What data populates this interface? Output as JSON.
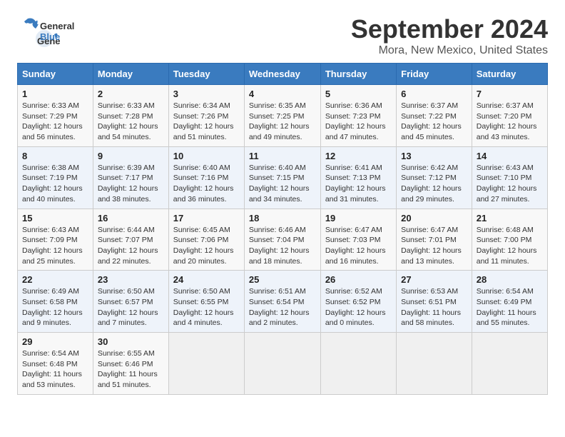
{
  "header": {
    "logo_general": "General",
    "logo_blue": "Blue",
    "month": "September 2024",
    "location": "Mora, New Mexico, United States"
  },
  "calendar": {
    "weekdays": [
      "Sunday",
      "Monday",
      "Tuesday",
      "Wednesday",
      "Thursday",
      "Friday",
      "Saturday"
    ],
    "weeks": [
      [
        {
          "day": "1",
          "info": "Sunrise: 6:33 AM\nSunset: 7:29 PM\nDaylight: 12 hours\nand 56 minutes."
        },
        {
          "day": "2",
          "info": "Sunrise: 6:33 AM\nSunset: 7:28 PM\nDaylight: 12 hours\nand 54 minutes."
        },
        {
          "day": "3",
          "info": "Sunrise: 6:34 AM\nSunset: 7:26 PM\nDaylight: 12 hours\nand 51 minutes."
        },
        {
          "day": "4",
          "info": "Sunrise: 6:35 AM\nSunset: 7:25 PM\nDaylight: 12 hours\nand 49 minutes."
        },
        {
          "day": "5",
          "info": "Sunrise: 6:36 AM\nSunset: 7:23 PM\nDaylight: 12 hours\nand 47 minutes."
        },
        {
          "day": "6",
          "info": "Sunrise: 6:37 AM\nSunset: 7:22 PM\nDaylight: 12 hours\nand 45 minutes."
        },
        {
          "day": "7",
          "info": "Sunrise: 6:37 AM\nSunset: 7:20 PM\nDaylight: 12 hours\nand 43 minutes."
        }
      ],
      [
        {
          "day": "8",
          "info": "Sunrise: 6:38 AM\nSunset: 7:19 PM\nDaylight: 12 hours\nand 40 minutes."
        },
        {
          "day": "9",
          "info": "Sunrise: 6:39 AM\nSunset: 7:17 PM\nDaylight: 12 hours\nand 38 minutes."
        },
        {
          "day": "10",
          "info": "Sunrise: 6:40 AM\nSunset: 7:16 PM\nDaylight: 12 hours\nand 36 minutes."
        },
        {
          "day": "11",
          "info": "Sunrise: 6:40 AM\nSunset: 7:15 PM\nDaylight: 12 hours\nand 34 minutes."
        },
        {
          "day": "12",
          "info": "Sunrise: 6:41 AM\nSunset: 7:13 PM\nDaylight: 12 hours\nand 31 minutes."
        },
        {
          "day": "13",
          "info": "Sunrise: 6:42 AM\nSunset: 7:12 PM\nDaylight: 12 hours\nand 29 minutes."
        },
        {
          "day": "14",
          "info": "Sunrise: 6:43 AM\nSunset: 7:10 PM\nDaylight: 12 hours\nand 27 minutes."
        }
      ],
      [
        {
          "day": "15",
          "info": "Sunrise: 6:43 AM\nSunset: 7:09 PM\nDaylight: 12 hours\nand 25 minutes."
        },
        {
          "day": "16",
          "info": "Sunrise: 6:44 AM\nSunset: 7:07 PM\nDaylight: 12 hours\nand 22 minutes."
        },
        {
          "day": "17",
          "info": "Sunrise: 6:45 AM\nSunset: 7:06 PM\nDaylight: 12 hours\nand 20 minutes."
        },
        {
          "day": "18",
          "info": "Sunrise: 6:46 AM\nSunset: 7:04 PM\nDaylight: 12 hours\nand 18 minutes."
        },
        {
          "day": "19",
          "info": "Sunrise: 6:47 AM\nSunset: 7:03 PM\nDaylight: 12 hours\nand 16 minutes."
        },
        {
          "day": "20",
          "info": "Sunrise: 6:47 AM\nSunset: 7:01 PM\nDaylight: 12 hours\nand 13 minutes."
        },
        {
          "day": "21",
          "info": "Sunrise: 6:48 AM\nSunset: 7:00 PM\nDaylight: 12 hours\nand 11 minutes."
        }
      ],
      [
        {
          "day": "22",
          "info": "Sunrise: 6:49 AM\nSunset: 6:58 PM\nDaylight: 12 hours\nand 9 minutes."
        },
        {
          "day": "23",
          "info": "Sunrise: 6:50 AM\nSunset: 6:57 PM\nDaylight: 12 hours\nand 7 minutes."
        },
        {
          "day": "24",
          "info": "Sunrise: 6:50 AM\nSunset: 6:55 PM\nDaylight: 12 hours\nand 4 minutes."
        },
        {
          "day": "25",
          "info": "Sunrise: 6:51 AM\nSunset: 6:54 PM\nDaylight: 12 hours\nand 2 minutes."
        },
        {
          "day": "26",
          "info": "Sunrise: 6:52 AM\nSunset: 6:52 PM\nDaylight: 12 hours\nand 0 minutes."
        },
        {
          "day": "27",
          "info": "Sunrise: 6:53 AM\nSunset: 6:51 PM\nDaylight: 11 hours\nand 58 minutes."
        },
        {
          "day": "28",
          "info": "Sunrise: 6:54 AM\nSunset: 6:49 PM\nDaylight: 11 hours\nand 55 minutes."
        }
      ],
      [
        {
          "day": "29",
          "info": "Sunrise: 6:54 AM\nSunset: 6:48 PM\nDaylight: 11 hours\nand 53 minutes."
        },
        {
          "day": "30",
          "info": "Sunrise: 6:55 AM\nSunset: 6:46 PM\nDaylight: 11 hours\nand 51 minutes."
        },
        {
          "day": "",
          "info": ""
        },
        {
          "day": "",
          "info": ""
        },
        {
          "day": "",
          "info": ""
        },
        {
          "day": "",
          "info": ""
        },
        {
          "day": "",
          "info": ""
        }
      ]
    ]
  }
}
